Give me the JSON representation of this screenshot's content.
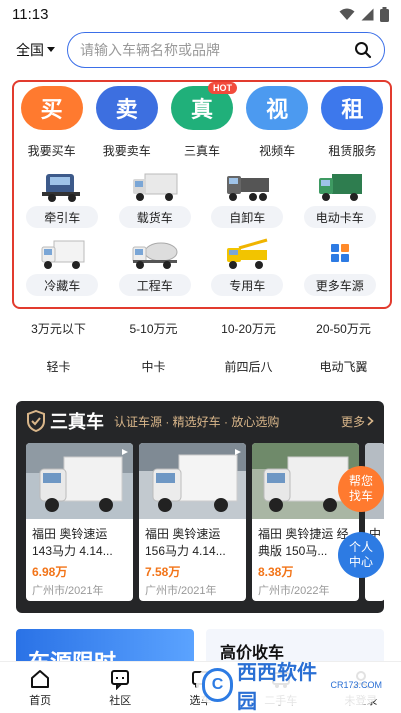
{
  "status": {
    "time": "11:13"
  },
  "header": {
    "city": "全国",
    "search_placeholder": "请输入车辆名称或品牌"
  },
  "main_entries": [
    {
      "char": "买",
      "label": "我要买车",
      "color": "#ff7a2f"
    },
    {
      "char": "卖",
      "label": "我要卖车",
      "color": "#3d6fe0"
    },
    {
      "char": "真",
      "label": "三真车",
      "color": "#20b07a",
      "badge": "HOT"
    },
    {
      "char": "视",
      "label": "视频车",
      "color": "#4c9af0"
    },
    {
      "char": "租",
      "label": "租赁服务",
      "color": "#3d78ec"
    }
  ],
  "truck_types": [
    {
      "label": "牵引车",
      "icon": "tractor-truck-icon"
    },
    {
      "label": "载货车",
      "icon": "cargo-truck-icon"
    },
    {
      "label": "自卸车",
      "icon": "dump-truck-icon"
    },
    {
      "label": "电动卡车",
      "icon": "electric-truck-icon"
    },
    {
      "label": "冷藏车",
      "icon": "refrigerated-truck-icon"
    },
    {
      "label": "工程车",
      "icon": "engineering-truck-icon"
    },
    {
      "label": "专用车",
      "icon": "special-vehicle-icon"
    },
    {
      "label": "更多车源",
      "icon": "more-grid-icon"
    }
  ],
  "filters": [
    "3万元以下",
    "5-10万元",
    "10-20万元",
    "20-50万元",
    "轻卡",
    "中卡",
    "前四后八",
    "电动飞翼"
  ],
  "sanzhen": {
    "title": "三真车",
    "subtitle": "认证车源 · 精选好车 · 放心选购",
    "more": "更多",
    "cards": [
      {
        "title": "福田 奥铃速运 143马力 4.14...",
        "price": "6.98万",
        "meta": "广州市/2021年"
      },
      {
        "title": "福田 奥铃速运 156马力 4.14...",
        "price": "7.58万",
        "meta": "广州市/2021年"
      },
      {
        "title": "福田 奥铃捷运 经典版 150马...",
        "price": "8.38万",
        "meta": "广州市/2022年"
      },
      {
        "title": "中"
      }
    ]
  },
  "floating": {
    "find": "帮您找车",
    "center": "个人中心"
  },
  "promo": {
    "left": "车源限时",
    "right": "高价收车"
  },
  "tabs": [
    {
      "label": "首页",
      "icon": "home-icon"
    },
    {
      "label": "社区",
      "icon": "chat-icon"
    },
    {
      "label": "选车",
      "icon": "truck-select-icon"
    },
    {
      "label": "二手车",
      "icon": "used-truck-icon"
    },
    {
      "label": "未登录",
      "icon": "user-icon"
    }
  ],
  "watermark": {
    "logo": "C",
    "text": "西西软件园",
    "sub": "CR173.COM"
  },
  "colors": {
    "accent": "#3b6fe8",
    "price": "#f27418",
    "highlight_border": "#e23b2e",
    "float_orange": "#ff7a2f",
    "float_blue": "#2d7be3"
  }
}
